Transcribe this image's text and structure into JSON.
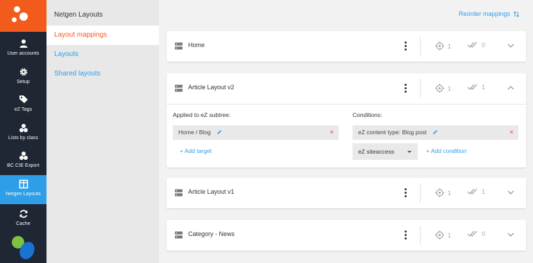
{
  "rail": {
    "items": [
      {
        "label": "User accounts",
        "icon": "user-icon"
      },
      {
        "label": "Setup",
        "icon": "gear-icon"
      },
      {
        "label": "eZ Tags",
        "icon": "tags-icon"
      },
      {
        "label": "Lists by class",
        "icon": "cubes-icon"
      },
      {
        "label": "BC CIE Export",
        "icon": "cubes-icon"
      },
      {
        "label": "Netgen Layouts",
        "icon": "layout-icon"
      },
      {
        "label": "Cache",
        "icon": "refresh-icon"
      }
    ],
    "active_index": 5
  },
  "submenu": {
    "title": "Netgen Layouts",
    "items": [
      "Layout mappings",
      "Layouts",
      "Shared layouts"
    ],
    "active_index": 0
  },
  "main": {
    "reorder_label": "Reorder mappings",
    "cards": [
      {
        "title": "Home",
        "targets": "1",
        "conditions": "0",
        "expanded": false
      },
      {
        "title": "Article Layout v2",
        "targets": "1",
        "conditions": "1",
        "expanded": true,
        "applied_label": "Applied to eZ subtree:",
        "target_value": "Home / Blog",
        "add_target": "+ Add target",
        "conditions_label": "Conditions:",
        "condition_value": "eZ content type: Blog post",
        "condition_select": "eZ siteaccess",
        "add_condition": "+ Add condition"
      },
      {
        "title": "Article Layout v1",
        "targets": "1",
        "conditions": "1",
        "expanded": false
      },
      {
        "title": "Category - News",
        "targets": "1",
        "conditions": "0",
        "expanded": false
      }
    ]
  },
  "colors": {
    "brand_orange": "#f35b1c",
    "accent_blue": "#2f9ee8",
    "rail_dark": "#1e2733",
    "remove_pink": "#e5347a"
  }
}
